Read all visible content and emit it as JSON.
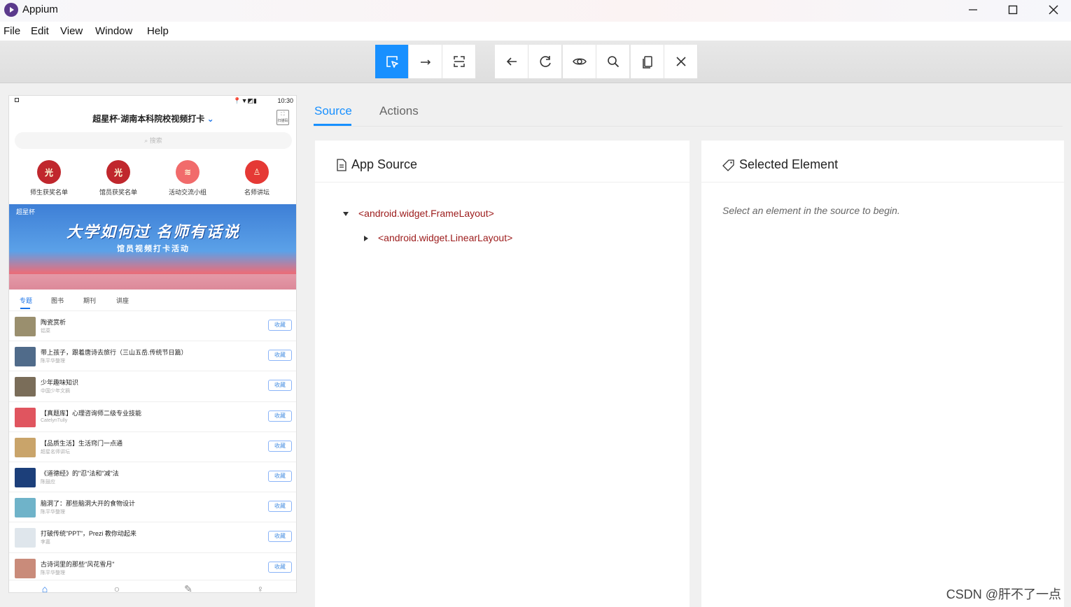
{
  "window": {
    "title": "Appium"
  },
  "menu": [
    "File",
    "Edit",
    "View",
    "Window",
    "Help"
  ],
  "phone": {
    "time": "10:30",
    "app_title": "超星杯·湖南本科院校视频打卡",
    "search_placeholder": "搜索",
    "scan_label": "扫描码",
    "categories": [
      "师生获奖名单",
      "馆员获奖名单",
      "活动交流小组",
      "名师讲坛"
    ],
    "banner": {
      "tag": "超星杯",
      "headline": "大学如何过 名师有话说",
      "sub": "馆员视频打卡活动"
    },
    "tabs": [
      "专题",
      "图书",
      "期刊",
      "讲座"
    ],
    "fav_label": "收藏",
    "items": [
      {
        "title": "陶瓷赏析",
        "sub": "铝菜"
      },
      {
        "title": "带上孩子，跟着唐诗去旅行（三山五岳.传统节日篇）",
        "sub": "陈平华整理"
      },
      {
        "title": "少年趣味知识",
        "sub": "中国少年文摘"
      },
      {
        "title": "【真题库】心理咨询师二级专业技能",
        "sub": "CatelynTully"
      },
      {
        "title": "【品质生活】生活窍门一点通",
        "sub": "超星名师讲坛"
      },
      {
        "title": "《道德经》的\"忍\"法和\"减\"法",
        "sub": "陈鼓应"
      },
      {
        "title": "脑洞了：那些脑洞大开的食物设计",
        "sub": "陈平华整理"
      },
      {
        "title": "打破传统\"PPT\"，Prezi 教你动起来",
        "sub": "李嘉"
      },
      {
        "title": "古诗词里的那些\"风花雪月\"",
        "sub": "陈平华整理"
      }
    ],
    "bottom_nav": [
      "首页",
      "消息",
      "笔记",
      "我"
    ]
  },
  "inspector": {
    "tabs": [
      "Source",
      "Actions"
    ],
    "app_source_title": "App Source",
    "tree": [
      "<android.widget.FrameLayout>",
      "<android.widget.LinearLayout>"
    ],
    "selected_title": "Selected Element",
    "selected_hint": "Select an element in the source to begin."
  },
  "watermark": "CSDN @肝不了一点",
  "colors": {
    "accent": "#1890ff",
    "node": "#9c1b1b"
  }
}
